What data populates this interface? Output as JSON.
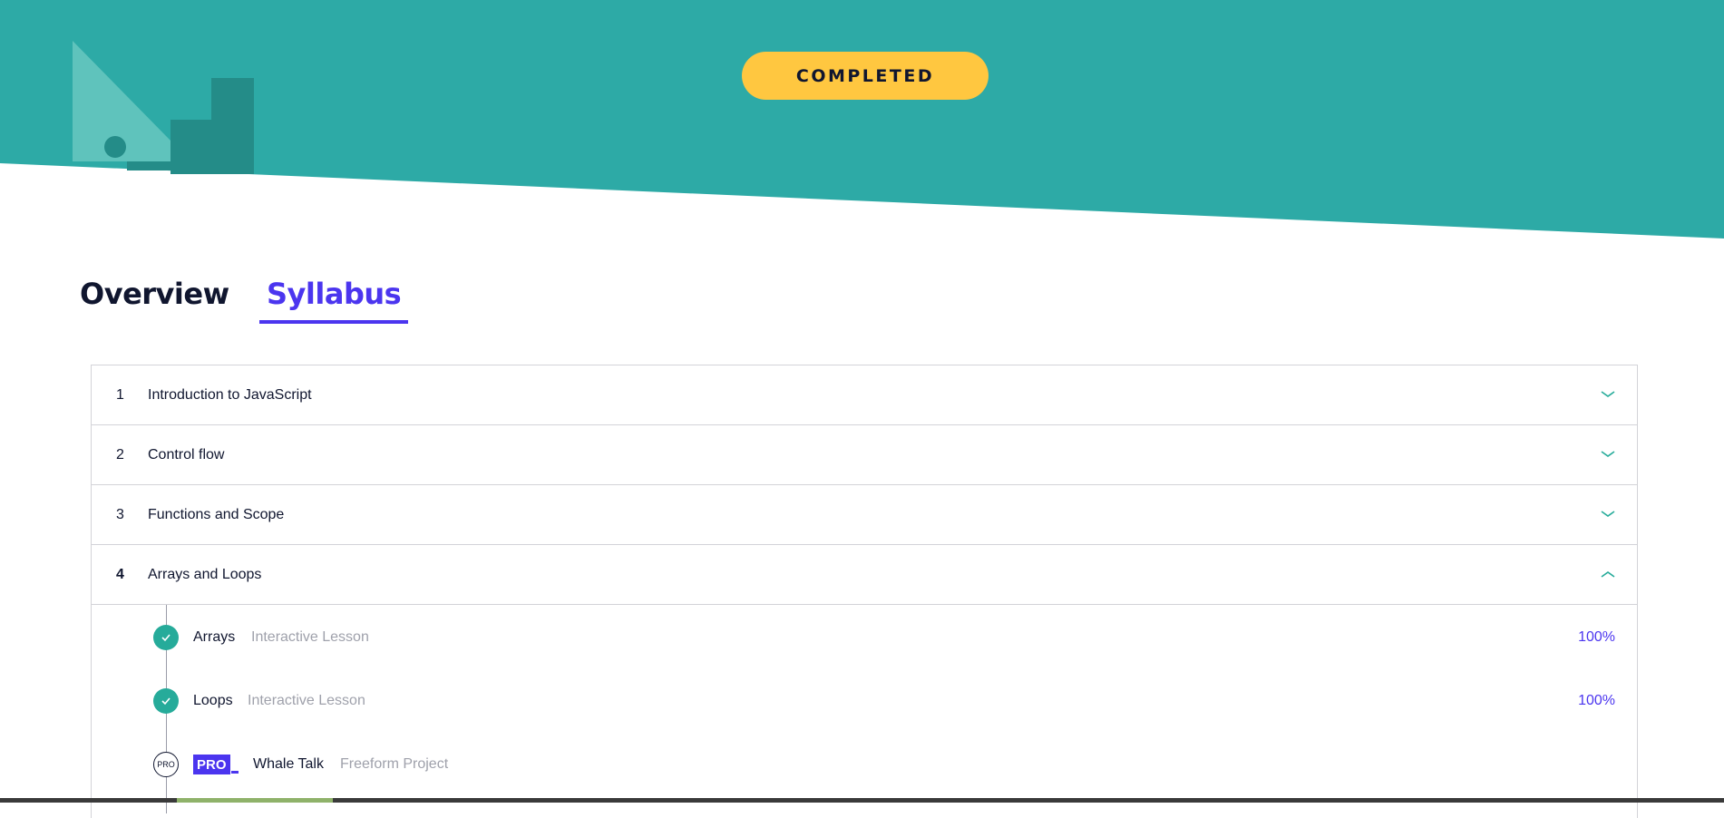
{
  "hero": {
    "status_label": "COMPLETED",
    "colors": {
      "background": "#2daaa6",
      "accent": "#ffc740"
    }
  },
  "tabs": [
    {
      "label": "Overview",
      "active": false
    },
    {
      "label": "Syllabus",
      "active": true
    }
  ],
  "syllabus": {
    "modules": [
      {
        "number": "1",
        "title": "Introduction to JavaScript",
        "expanded": false,
        "chevron": "chevron-down-icon"
      },
      {
        "number": "2",
        "title": "Control flow",
        "expanded": false,
        "chevron": "chevron-down-icon"
      },
      {
        "number": "3",
        "title": "Functions and Scope",
        "expanded": false,
        "chevron": "chevron-down-icon"
      },
      {
        "number": "4",
        "title": "Arrays and Loops",
        "expanded": true,
        "chevron": "chevron-up-icon"
      }
    ],
    "lessons": [
      {
        "name": "Arrays",
        "kind": "Interactive Lesson",
        "progress": "100%",
        "status": "complete",
        "icon": "check-icon"
      },
      {
        "name": "Loops",
        "kind": "Interactive Lesson",
        "progress": "100%",
        "status": "complete",
        "icon": "check-icon"
      },
      {
        "name": "Whale Talk",
        "kind": "Freeform Project",
        "status": "pro",
        "icon_label": "PRO",
        "badge": "PRO"
      }
    ]
  },
  "colors": {
    "accent": "#4b35ef",
    "success": "#26ab9a",
    "text": "#10162f",
    "muted": "#9fa1ab"
  }
}
